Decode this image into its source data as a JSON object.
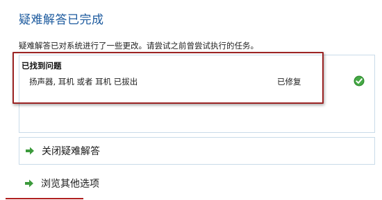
{
  "header": {
    "title": "疑难解答已完成"
  },
  "description": "疑难解答已对系统进行了一些更改。请尝试之前曾尝试执行的任务。",
  "results": {
    "header": "已找到问题",
    "items": [
      {
        "name": "扬声器, 耳机 或者 耳机 已拔出",
        "status": "已修复",
        "status_icon": "check-icon"
      }
    ]
  },
  "actions": [
    {
      "label": "关闭疑难解答",
      "icon": "green-arrow-icon"
    },
    {
      "label": "浏览其他选项",
      "icon": "green-arrow-icon"
    }
  ],
  "colors": {
    "title": "#1c5a9e",
    "highlight": "#9b2323",
    "arrow": "#3c9a3c",
    "check": "#2e8b2e"
  }
}
